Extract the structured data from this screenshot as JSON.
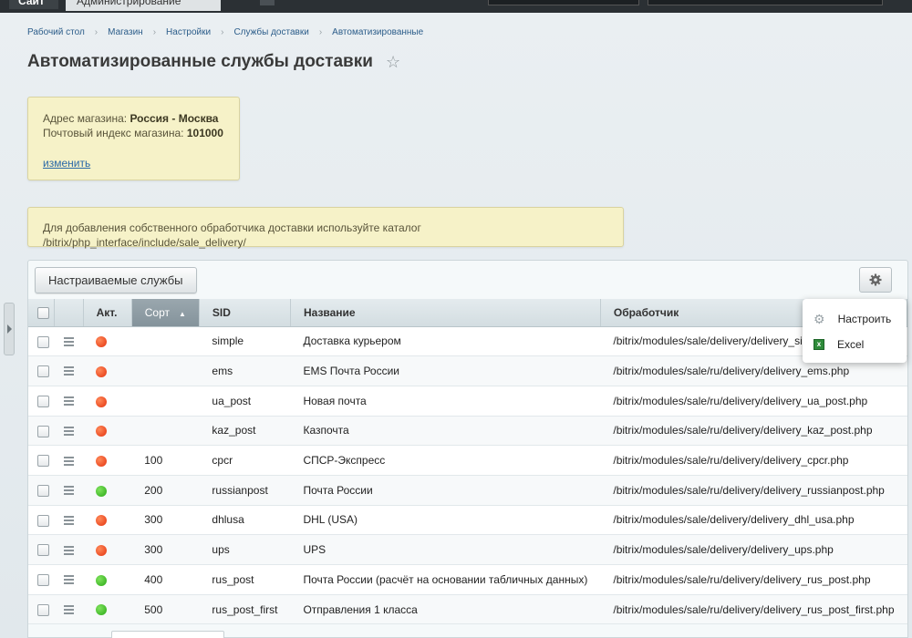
{
  "topbar": {
    "site_tab": "Сайт",
    "admin_tab": "Администрирование"
  },
  "breadcrumb": [
    "Рабочий стол",
    "Магазин",
    "Настройки",
    "Службы доставки",
    "Автоматизированные"
  ],
  "page_title": "Автоматизированные службы доставки",
  "note_address": {
    "address_label": "Адрес магазина:",
    "address_value": "Россия - Москва",
    "zip_label": "Почтовый индекс магазина:",
    "zip_value": "101000",
    "change_link": "изменить"
  },
  "note_info": "Для добавления собственного обработчика доставки используйте каталог /bitrix/php_interface/include/sale_delivery/",
  "toolbar": {
    "configurable_button": "Настраиваемые службы"
  },
  "table": {
    "columns": {
      "active": "Акт.",
      "sort": "Сорт",
      "sid": "SID",
      "name": "Название",
      "handler": "Обработчик"
    },
    "rows": [
      {
        "active": "red",
        "sort": "",
        "sid": "simple",
        "name": "Доставка курьером",
        "handler": "/bitrix/modules/sale/delivery/delivery_simple.php"
      },
      {
        "active": "red",
        "sort": "",
        "sid": "ems",
        "name": "EMS Почта России",
        "handler": "/bitrix/modules/sale/ru/delivery/delivery_ems.php"
      },
      {
        "active": "red",
        "sort": "",
        "sid": "ua_post",
        "name": "Новая почта",
        "handler": "/bitrix/modules/sale/ru/delivery/delivery_ua_post.php"
      },
      {
        "active": "red",
        "sort": "",
        "sid": "kaz_post",
        "name": "Казпочта",
        "handler": "/bitrix/modules/sale/ru/delivery/delivery_kaz_post.php"
      },
      {
        "active": "red",
        "sort": "100",
        "sid": "cpcr",
        "name": "СПСР-Экспресс",
        "handler": "/bitrix/modules/sale/ru/delivery/delivery_cpcr.php"
      },
      {
        "active": "green",
        "sort": "200",
        "sid": "russianpost",
        "name": "Почта России",
        "handler": "/bitrix/modules/sale/ru/delivery/delivery_russianpost.php"
      },
      {
        "active": "red",
        "sort": "300",
        "sid": "dhlusa",
        "name": "DHL (USA)",
        "handler": "/bitrix/modules/sale/delivery/delivery_dhl_usa.php"
      },
      {
        "active": "red",
        "sort": "300",
        "sid": "ups",
        "name": "UPS",
        "handler": "/bitrix/modules/sale/delivery/delivery_ups.php"
      },
      {
        "active": "green",
        "sort": "400",
        "sid": "rus_post",
        "name": "Почта России (расчёт на основании табличных данных)",
        "handler": "/bitrix/modules/sale/ru/delivery/delivery_rus_post.php"
      },
      {
        "active": "green",
        "sort": "500",
        "sid": "rus_post_first",
        "name": "Отправления 1 класса",
        "handler": "/bitrix/modules/sale/ru/delivery/delivery_rus_post_first.php"
      }
    ]
  },
  "popup_menu": {
    "configure": "Настроить",
    "excel": "Excel"
  },
  "colors": {
    "status_red": "#e4330e",
    "status_green": "#2aa817",
    "note_bg": "#f6f2c8",
    "link": "#2a69a8"
  }
}
